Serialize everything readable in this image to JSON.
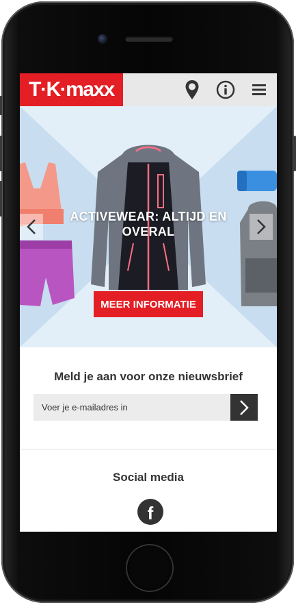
{
  "header": {
    "logo_text": "T·K·maxx",
    "icons": [
      "location-pin-icon",
      "info-icon",
      "menu-icon"
    ]
  },
  "hero": {
    "title": "ACTIVEWEAR: ALTIJD EN OVERAL",
    "cta_label": "MEER INFORMATIE",
    "slide_count": 6,
    "active_slide": 1
  },
  "newsletter": {
    "title": "Meld je aan voor onze nieuwsbrief",
    "placeholder": "Voer je e-mailadres in"
  },
  "social": {
    "title": "Social media",
    "facebook_glyph": "f"
  },
  "colors": {
    "brand_red": "#e31e24",
    "dark": "#333333"
  }
}
